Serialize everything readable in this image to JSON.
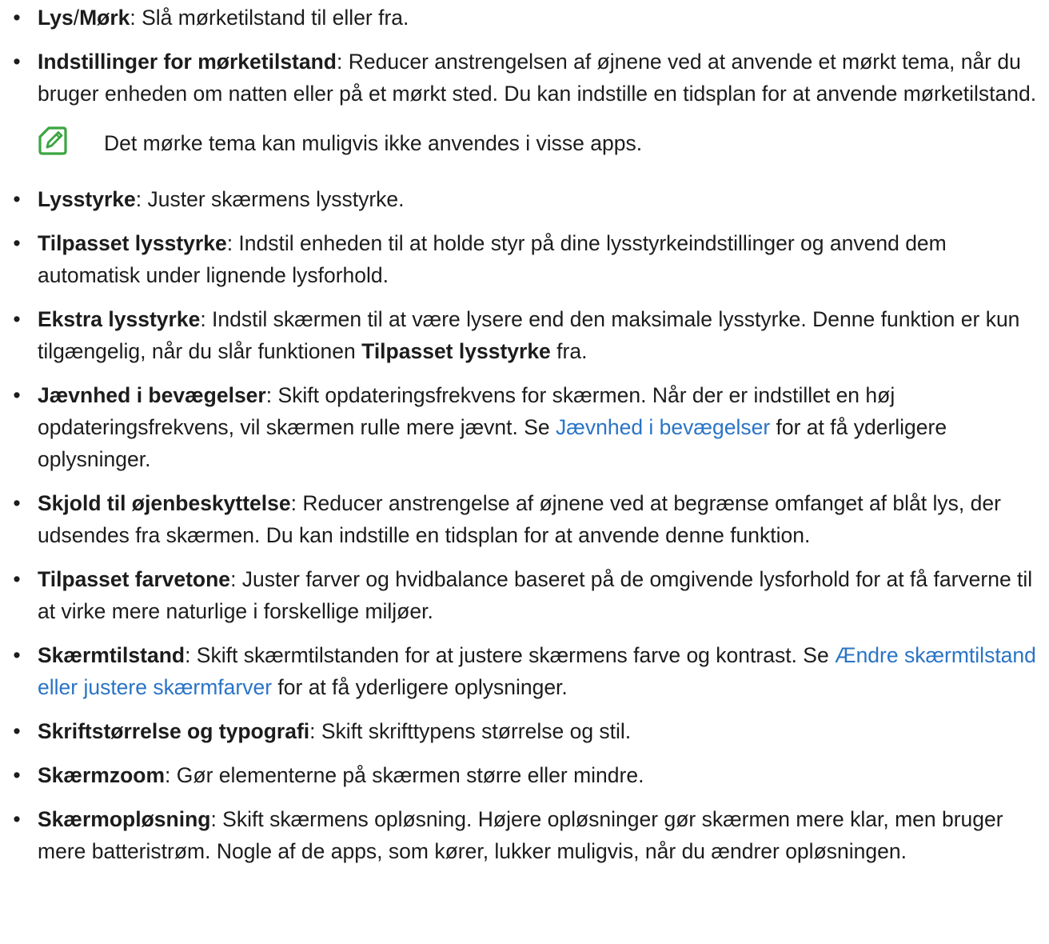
{
  "items": [
    {
      "term": "Lys",
      "sep": "/",
      "term2": "Mørk",
      "desc": ": Slå mørketilstand til eller fra."
    },
    {
      "term": "Indstillinger for mørketilstand",
      "desc": ": Reducer anstrengelsen af øjnene ved at anvende et mørkt tema, når du bruger enheden om natten eller på et mørkt sted. Du kan indstille en tidsplan for at anvende mørketilstand."
    },
    {
      "term": "Lysstyrke",
      "desc": ": Juster skærmens lysstyrke."
    },
    {
      "term": "Tilpasset lysstyrke",
      "desc": ": Indstil enheden til at holde styr på dine lysstyrkeindstillinger og anvend dem automatisk under lignende lysforhold."
    },
    {
      "term": "Ekstra lysstyrke",
      "desc_a": ": Indstil skærmen til at være lysere end den maksimale lysstyrke. Denne funktion er kun tilgængelig, når du slår funktionen ",
      "inline_bold": "Tilpasset lysstyrke",
      "desc_b": " fra."
    },
    {
      "term": "Jævnhed i bevægelser",
      "desc_a": ": Skift opdateringsfrekvens for skærmen. Når der er indstillet en høj opdateringsfrekvens, vil skærmen rulle mere jævnt. Se ",
      "link": "Jævnhed i bevægelser",
      "desc_b": " for at få yderligere oplysninger."
    },
    {
      "term": "Skjold til øjenbeskyttelse",
      "desc": ": Reducer anstrengelse af øjnene ved at begrænse omfanget af blåt lys, der udsendes fra skærmen. Du kan indstille en tidsplan for at anvende denne funktion."
    },
    {
      "term": "Tilpasset farvetone",
      "desc": ": Juster farver og hvidbalance baseret på de omgivende lysforhold for at få farverne til at virke mere naturlige i forskellige miljøer."
    },
    {
      "term": "Skærmtilstand",
      "desc_a": ": Skift skærmtilstanden for at justere skærmens farve og kontrast. Se ",
      "link": "Ændre skærmtilstand eller justere skærmfarver",
      "desc_b": " for at få yderligere oplysninger."
    },
    {
      "term": "Skriftstørrelse og typografi",
      "desc": ": Skift skrifttypens størrelse og stil."
    },
    {
      "term": "Skærmzoom",
      "desc": ": Gør elementerne på skærmen større eller mindre."
    },
    {
      "term": "Skærmopløsning",
      "desc": ": Skift skærmens opløsning. Højere opløsninger gør skærmen mere klar, men bruger mere batteristrøm. Nogle af de apps, som kører, lukker muligvis, når du ændrer opløsningen."
    }
  ],
  "note": {
    "icon": "note-pencil-icon",
    "text": "Det mørke tema kan muligvis ikke anvendes i visse apps."
  },
  "bullet": "•",
  "colors": {
    "text": "#1c1c1c",
    "link": "#2a74c6",
    "note_icon": "#3aa541"
  }
}
